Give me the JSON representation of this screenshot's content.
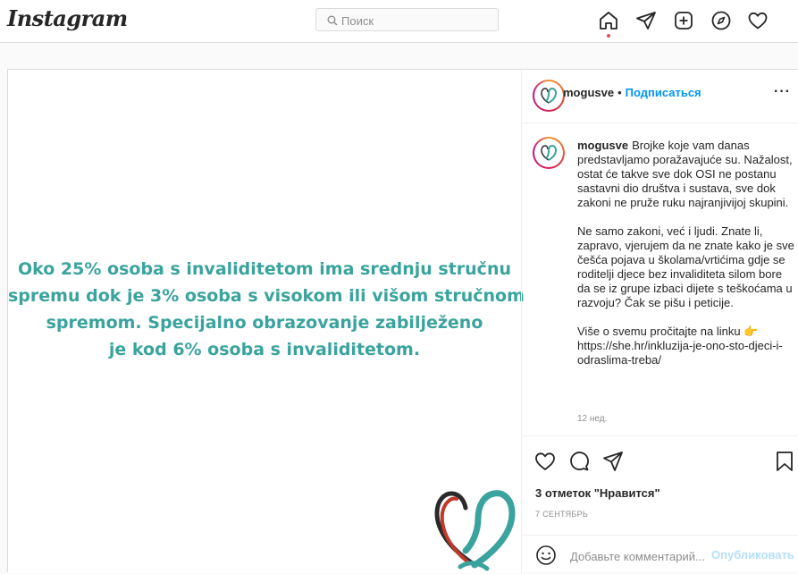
{
  "nav": {
    "logo": "Instagram",
    "search_placeholder": "Поиск",
    "icons": [
      "home-icon",
      "direct-icon",
      "new-post-icon",
      "explore-icon",
      "activity-icon"
    ]
  },
  "post": {
    "image_text": [
      "Oko 25% osoba s invaliditetom ima srednju stručnu",
      "spremu dok je 3% osoba s visokom ili višom stručnom",
      "spremom. Specijalno obrazovanje zabilježeno",
      "je kod 6% osoba s invaliditetom."
    ],
    "username": "mogusve",
    "follow_label": "Подписаться",
    "more_label": "···",
    "caption_username": "mogusve",
    "caption_p1": "Brojke koje vam danas predstavljamo poražavajuće su. Nažalost, ostat će takve sve dok OSI ne postanu sastavni dio društva i sustava, sve dok zakoni ne pruže ruku najranjivijoj skupini.",
    "caption_p2": "Ne samo zakoni, već i ljudi. Znate li, zapravo, vjerujem da ne znate kako je sve češća pojava u školama/vrtićima gdje se roditelji djece bez invaliditeta silom bore da se iz grupe izbaci dijete s teškoćama u razvoju? Čak se pišu i peticije.",
    "caption_p3": "Više o svemu pročitajte na linku 👉https://she.hr/inkluzija-je-ono-sto-djeci-i-odraslima-treba/",
    "time_ago": "12 нед.",
    "likes": "3 отметок \"Нравится\"",
    "date": "7 СЕНТЯБРЬ",
    "comment_placeholder": "Добавьте комментарий...",
    "publish_label": "Опубликовать"
  },
  "colors": {
    "accent": "#0095f6",
    "image_text": "#3aa39d",
    "notification_dot": "#ed4956"
  }
}
